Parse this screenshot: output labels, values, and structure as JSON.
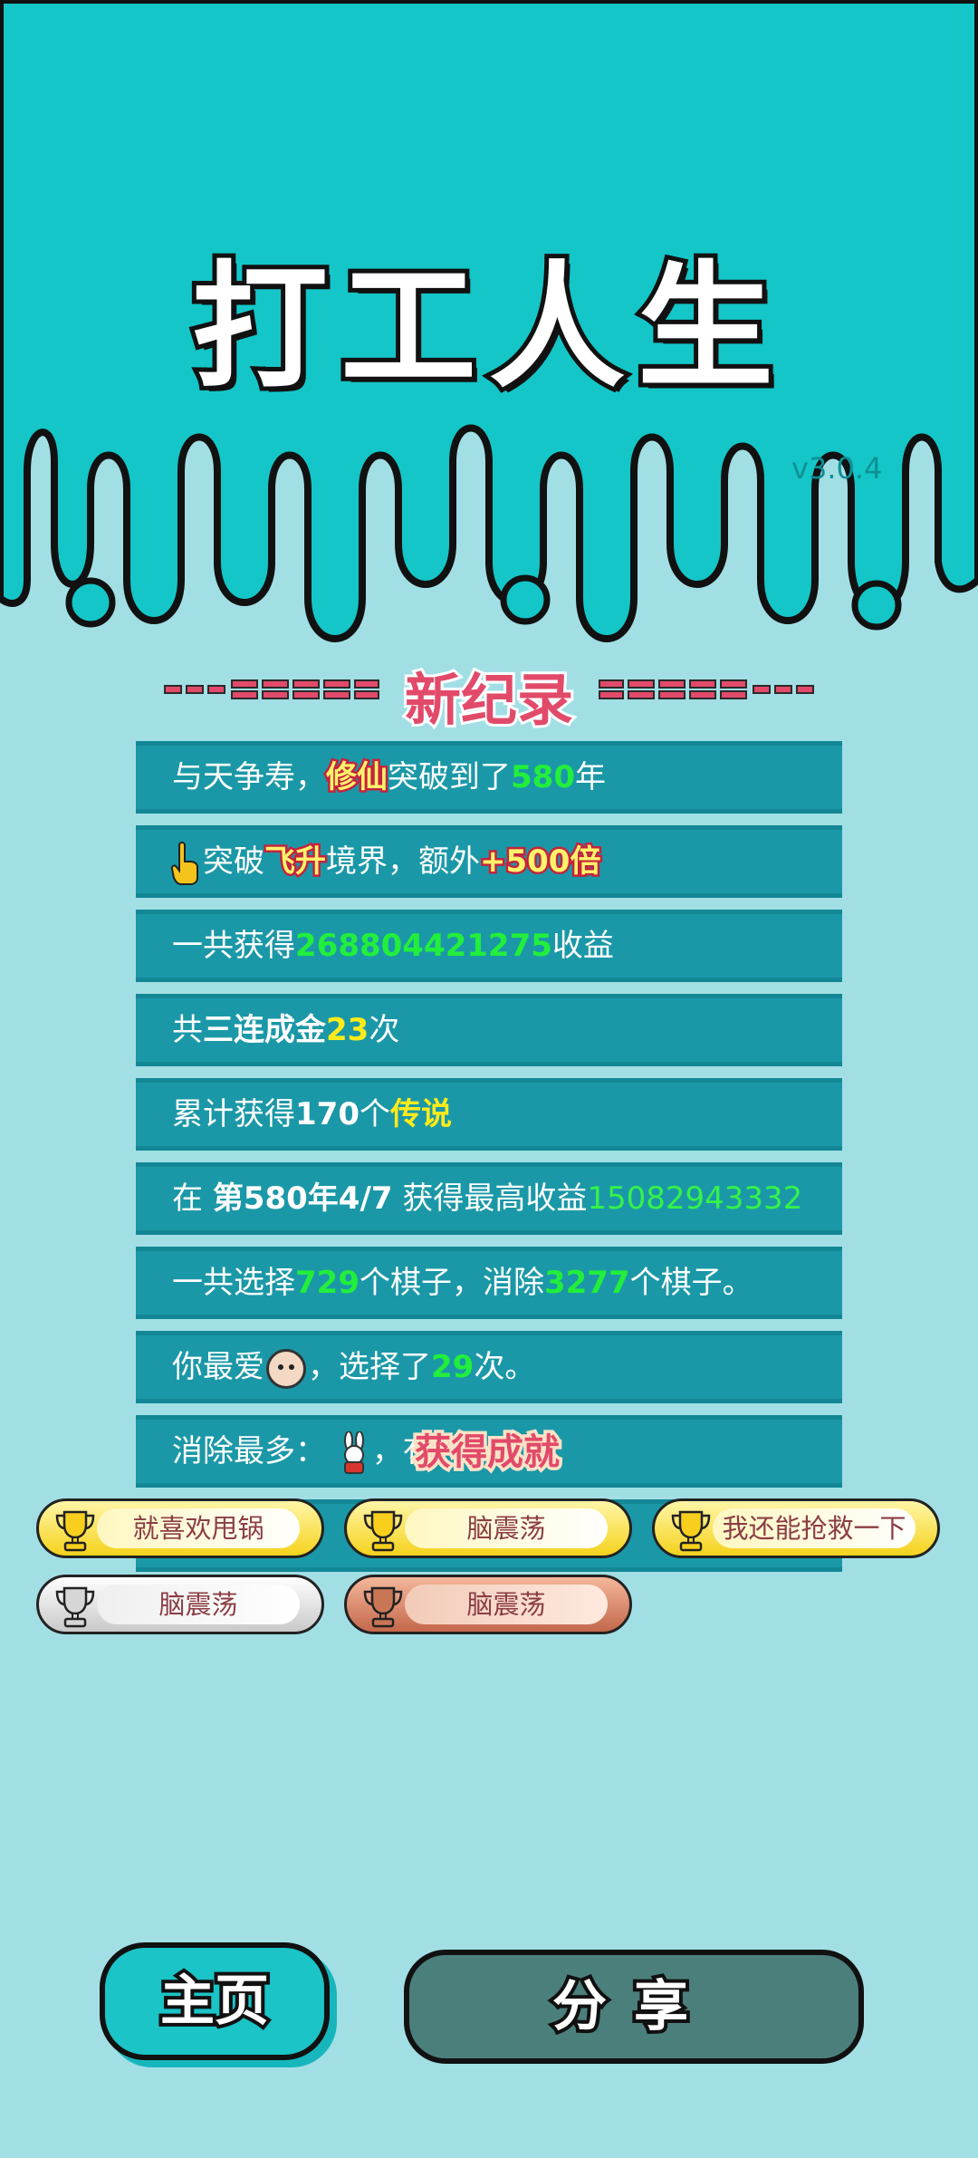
{
  "header": {
    "title": "打工人生",
    "version": "v3.0.4"
  },
  "record": {
    "title": "新纪录"
  },
  "rows": {
    "r1": {
      "a": "与天争寿，",
      "b": "修仙",
      "c": "突破到了",
      "d": "580",
      "e": "年"
    },
    "r2": {
      "b": "突破",
      "c": "飞升",
      "d": "境界，额外",
      "e": "+500倍"
    },
    "r3": {
      "a": "一共获得",
      "b": "268804421275",
      "c": "收益"
    },
    "r4": {
      "a": "共",
      "b": "三连成金",
      "c": "23",
      "d": "次"
    },
    "r5": {
      "a": "累计获得",
      "b": "170",
      "c": "个",
      "d": "传说"
    },
    "r6": {
      "a": "在 ",
      "b": "第580年4/7",
      "c": " 获得最高收益",
      "d": "15082943332"
    },
    "r7": {
      "a": "一共选择",
      "b": "729",
      "c": "个棋子，消除",
      "d": "3277",
      "e": "个棋子。"
    },
    "r8": {
      "a": "你最爱",
      "b": "，选择了",
      "c": "29",
      "d": "次。"
    },
    "r9": {
      "a": "消除最多：",
      "b": "，有"
    }
  },
  "achievement_popup": "获得成就",
  "badges": [
    {
      "label": "就喜欢甩锅",
      "tier": "gold"
    },
    {
      "label": "脑震荡",
      "tier": "gold"
    },
    {
      "label": "我还能抢救一下",
      "tier": "gold"
    },
    {
      "label": "脑震荡",
      "tier": "silver"
    },
    {
      "label": "脑震荡",
      "tier": "bronze"
    }
  ],
  "buttons": {
    "home": "主页",
    "share": "分享"
  },
  "colors": {
    "teal": "#14c6c8",
    "background": "#a2dfe5",
    "row": "#1b98a7",
    "accent_pink": "#e24a6a",
    "green": "#22ee3c",
    "yellow": "#ffeb1a"
  }
}
